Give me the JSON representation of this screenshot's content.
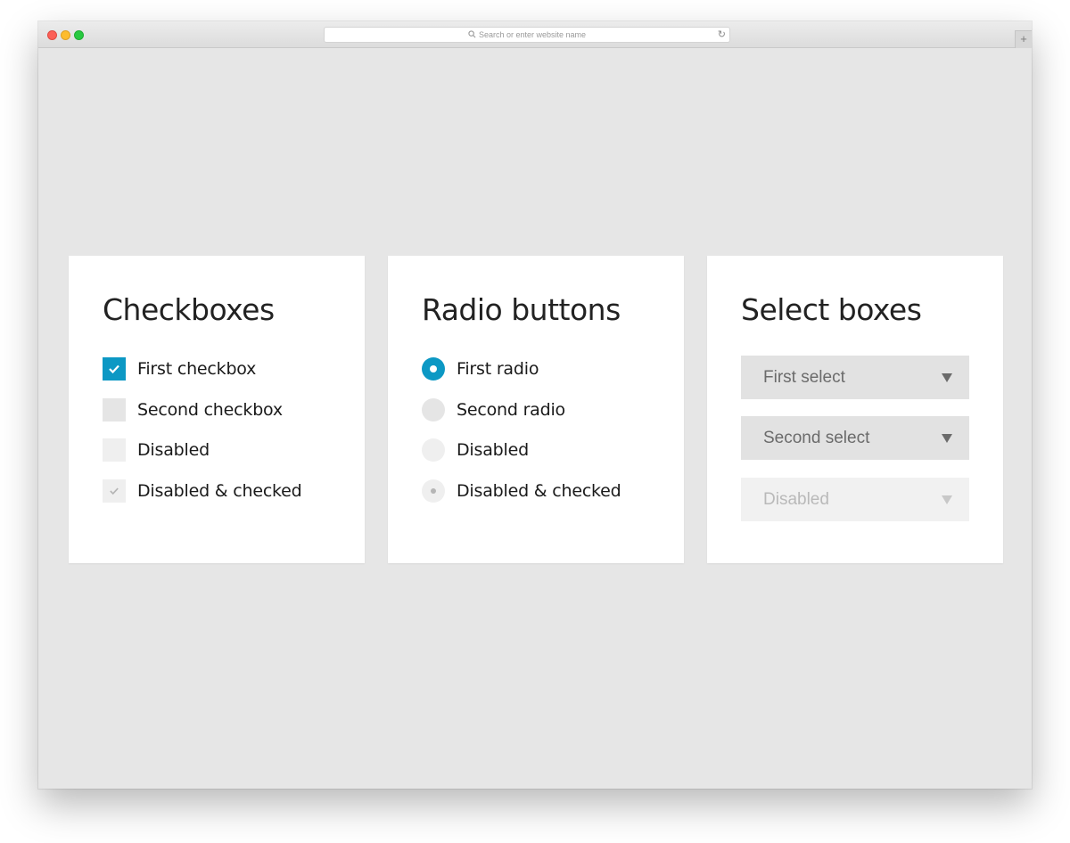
{
  "browser": {
    "address_placeholder": "Search or enter website name",
    "new_tab_label": "+"
  },
  "checkboxes": {
    "title": "Checkboxes",
    "items": [
      {
        "label": "First checkbox",
        "state": "checked"
      },
      {
        "label": "Second checkbox",
        "state": "unchecked"
      },
      {
        "label": "Disabled",
        "state": "disabled"
      },
      {
        "label": "Disabled & checked",
        "state": "disabled-checked"
      }
    ]
  },
  "radios": {
    "title": "Radio buttons",
    "items": [
      {
        "label": "First radio",
        "state": "checked"
      },
      {
        "label": "Second radio",
        "state": "unchecked"
      },
      {
        "label": "Disabled",
        "state": "disabled"
      },
      {
        "label": "Disabled & checked",
        "state": "disabled-checked"
      }
    ]
  },
  "selects": {
    "title": "Select boxes",
    "items": [
      {
        "label": "First select",
        "state": "enabled"
      },
      {
        "label": "Second select",
        "state": "enabled"
      },
      {
        "label": "Disabled",
        "state": "disabled"
      }
    ]
  },
  "colors": {
    "accent": "#0c98c4",
    "background": "#e6e6e6",
    "card": "#ffffff"
  }
}
